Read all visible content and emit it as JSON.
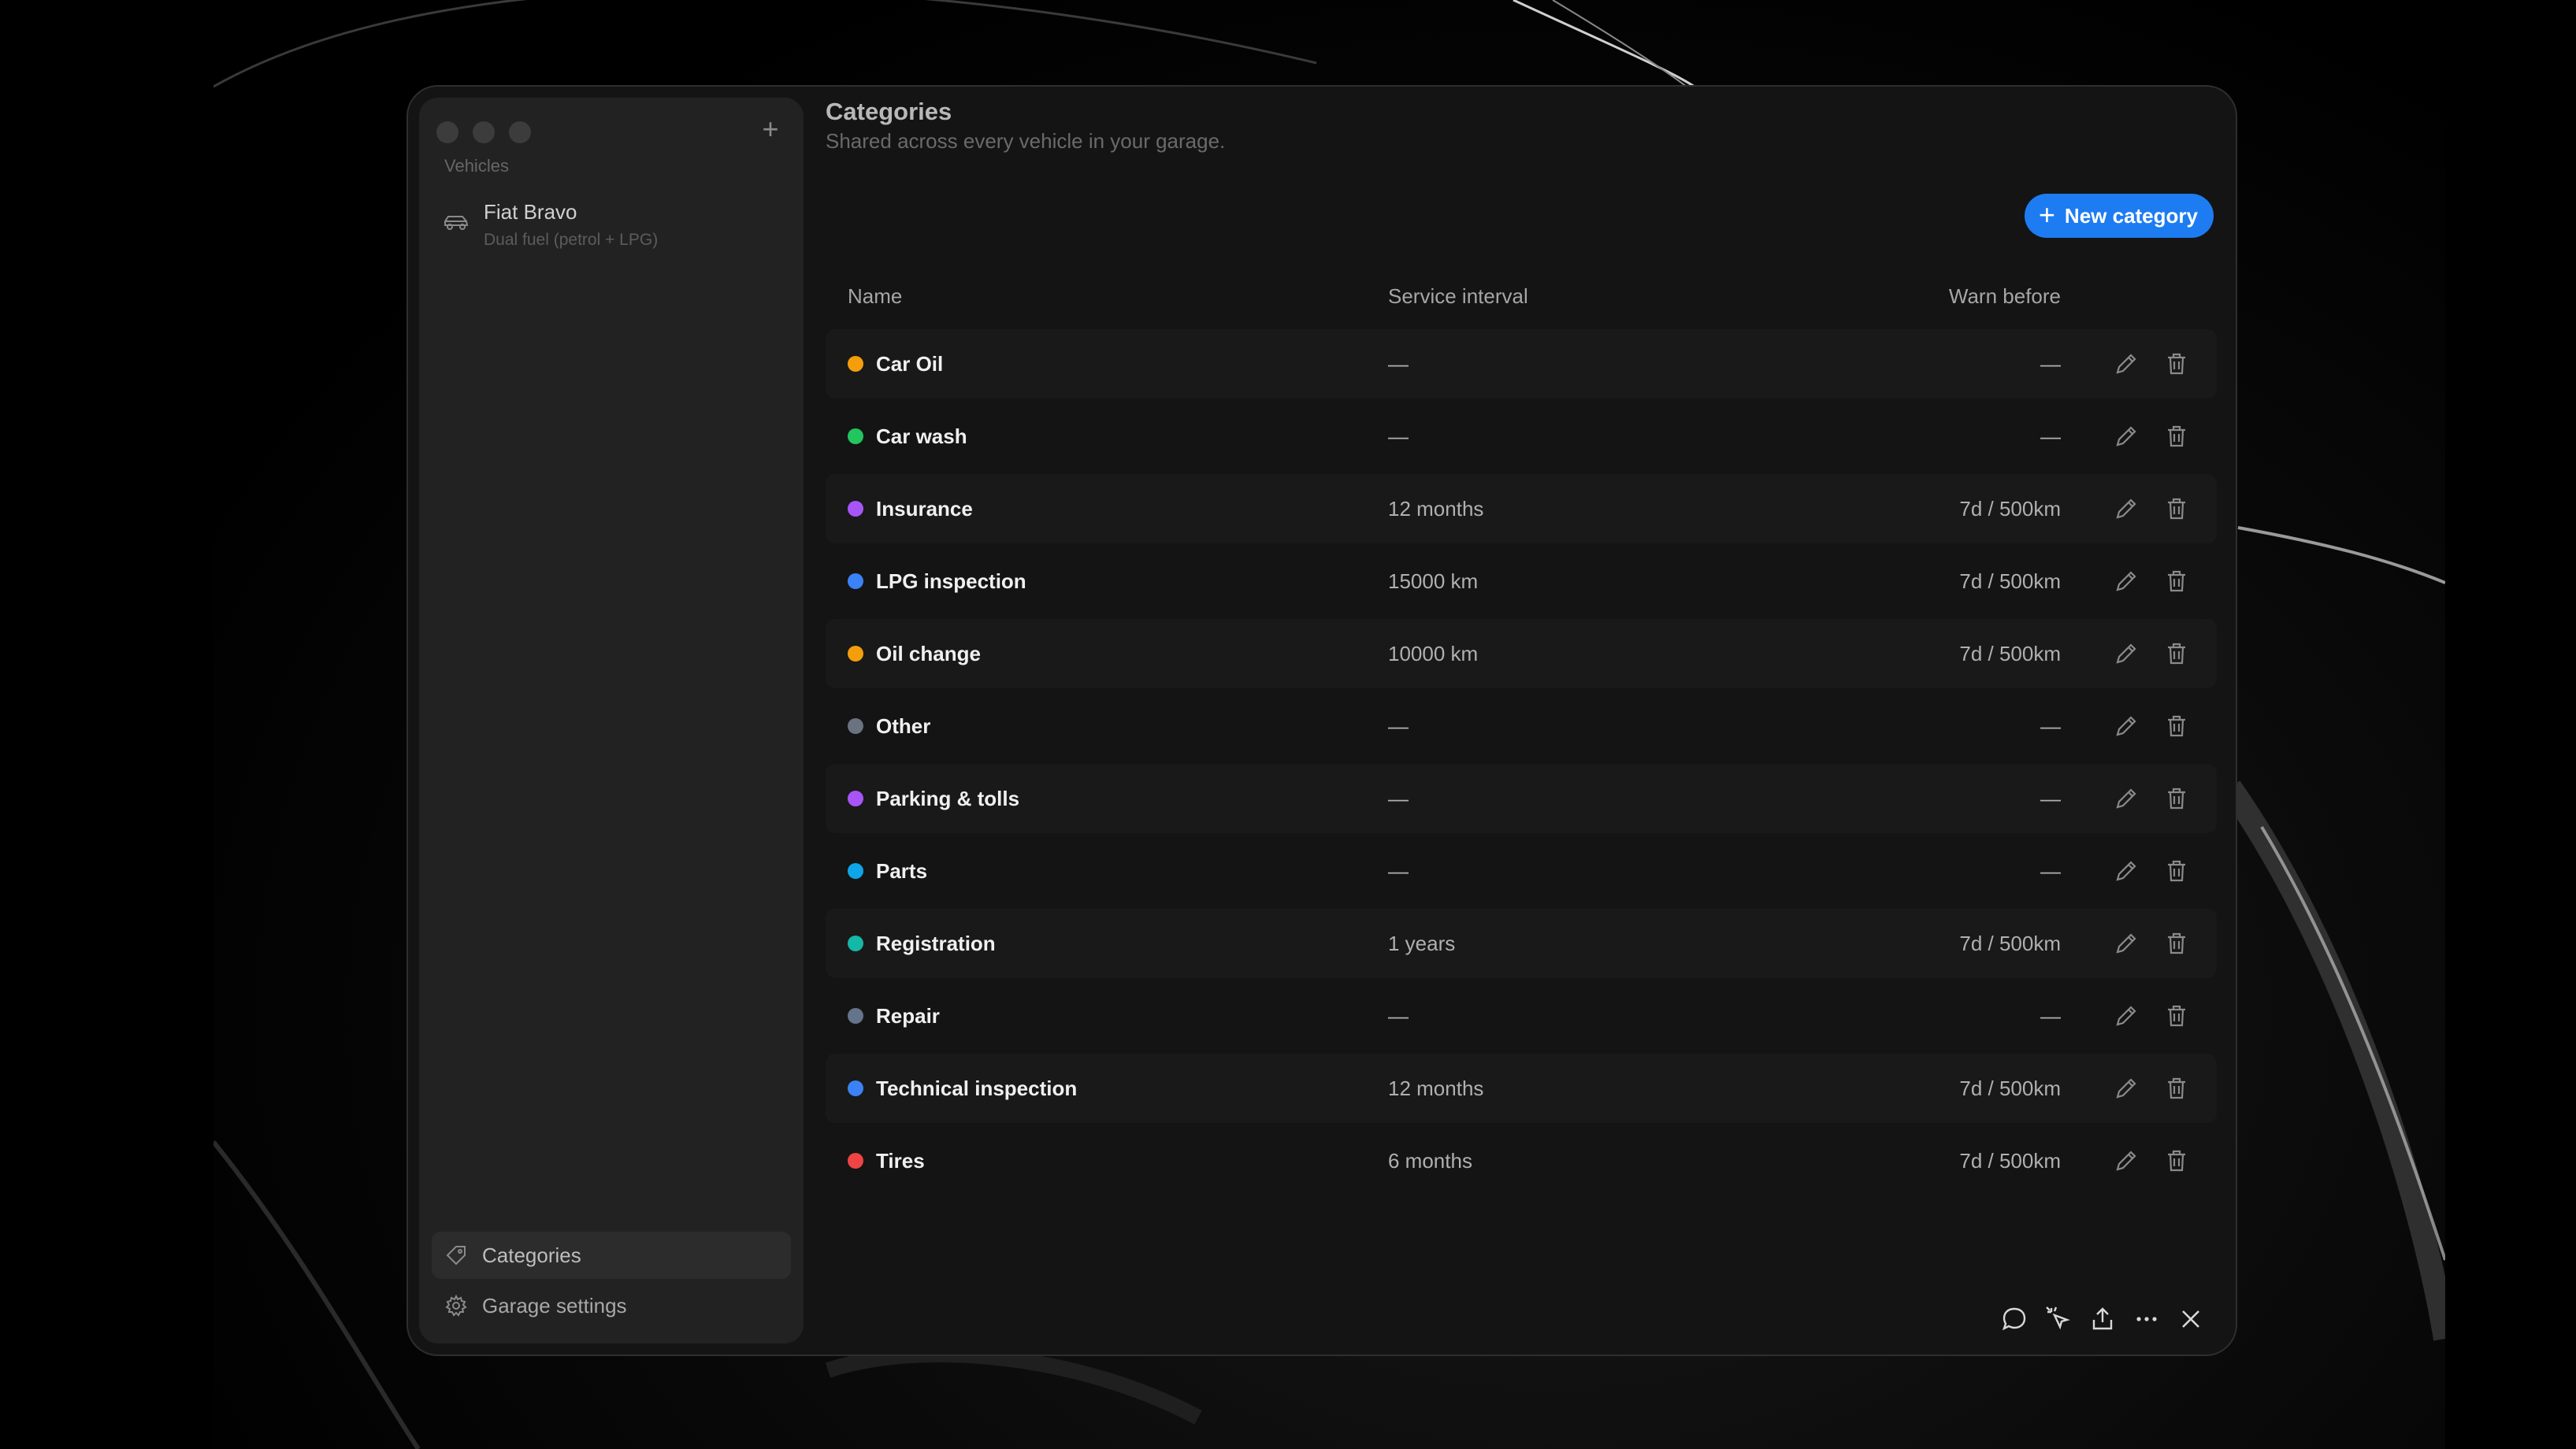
{
  "sidebar": {
    "section_label": "Vehicles",
    "add_icon": "plus-icon",
    "vehicle": {
      "name": "Fiat Bravo",
      "subtitle": "Dual fuel (petrol + LPG)",
      "icon": "car-icon"
    },
    "nav": [
      {
        "label": "Categories",
        "icon": "tag-icon",
        "active": true
      },
      {
        "label": "Garage settings",
        "icon": "gear-icon",
        "active": false
      }
    ]
  },
  "header": {
    "title": "Categories",
    "subtitle": "Shared across every vehicle in your garage.",
    "new_button": "New category"
  },
  "table": {
    "columns": {
      "name": "Name",
      "interval": "Service interval",
      "warn": "Warn before"
    },
    "rows": [
      {
        "name": "Car Oil",
        "color": "#f59e0b",
        "interval": "—",
        "warn": "—"
      },
      {
        "name": "Car wash",
        "color": "#22c55e",
        "interval": "—",
        "warn": "—"
      },
      {
        "name": "Insurance",
        "color": "#a855f7",
        "interval": "12 months",
        "warn": "7d / 500km"
      },
      {
        "name": "LPG inspection",
        "color": "#3b82f6",
        "interval": "15000 km",
        "warn": "7d / 500km"
      },
      {
        "name": "Oil change",
        "color": "#f59e0b",
        "interval": "10000 km",
        "warn": "7d / 500km"
      },
      {
        "name": "Other",
        "color": "#6b7280",
        "interval": "—",
        "warn": "—"
      },
      {
        "name": "Parking & tolls",
        "color": "#a855f7",
        "interval": "—",
        "warn": "—"
      },
      {
        "name": "Parts",
        "color": "#0ea5e9",
        "interval": "—",
        "warn": "—"
      },
      {
        "name": "Registration",
        "color": "#14b8a6",
        "interval": "1 years",
        "warn": "7d / 500km"
      },
      {
        "name": "Repair",
        "color": "#64748b",
        "interval": "—",
        "warn": "—"
      },
      {
        "name": "Technical inspection",
        "color": "#3b82f6",
        "interval": "12 months",
        "warn": "7d / 500km"
      },
      {
        "name": "Tires",
        "color": "#ef4444",
        "interval": "6 months",
        "warn": "7d / 500km"
      }
    ]
  },
  "toolbar": [
    "comment-icon",
    "cursor-sparkle-icon",
    "share-icon",
    "more-icon",
    "close-icon"
  ],
  "colors": {
    "accent": "#1e7cf2"
  }
}
